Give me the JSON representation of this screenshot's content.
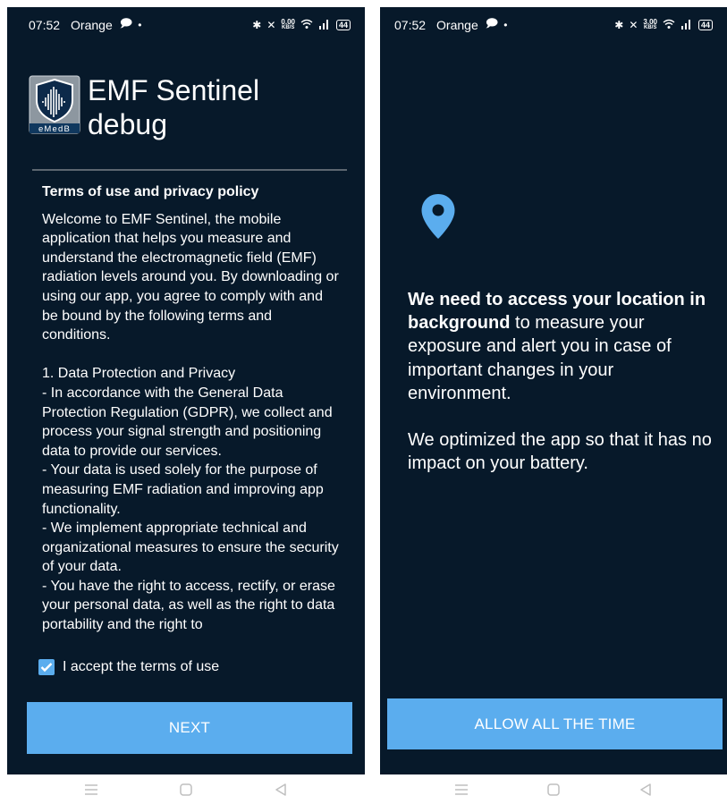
{
  "left_screen": {
    "status": {
      "time": "07:52",
      "carrier": "Orange",
      "netspeed_value": "0.00",
      "netspeed_unit": "KB/S",
      "battery": "44"
    },
    "app": {
      "logo_text": "eMedB",
      "title_line1": "EMF Sentinel",
      "title_line2": "debug"
    },
    "terms": {
      "heading": "Terms of use and privacy policy",
      "body": "Welcome to EMF Sentinel, the mobile application that helps you measure and understand the electromagnetic field (EMF) radiation levels around you. By downloading or using our app, you agree to comply with and be bound by the following terms and conditions.\n\n 1. Data Protection and Privacy\n - In accordance with the General Data Protection Regulation (GDPR), we collect and process your signal strength and positioning data to provide our services.\n - Your data is used solely for the purpose of measuring EMF radiation and improving app functionality.\n - We implement appropriate technical and organizational measures to ensure the security of your data.\n - You have the right to access, rectify, or erase your personal data, as well as the right to data portability and the right to"
    },
    "checkbox": {
      "label": "I accept the terms of use",
      "checked": true
    },
    "next_label": "NEXT"
  },
  "right_screen": {
    "status": {
      "time": "07:52",
      "carrier": "Orange",
      "netspeed_value": "3.00",
      "netspeed_unit": "KB/S",
      "battery": "44"
    },
    "message": {
      "bold": "We need to access your location in background",
      "rest": " to measure your exposure and alert you in case of important changes in your environment.",
      "battery_note": "We optimized the app so that it has no impact on your battery."
    },
    "allow_label": "ALLOW ALL THE TIME"
  },
  "colors": {
    "background": "#07192a",
    "accent": "#5badee",
    "divider": "#5c6670",
    "nav_icons": "#bfbfbf"
  },
  "icons": {
    "status": [
      "chat-bubble-icon",
      "dot-icon",
      "bluetooth-icon",
      "mute-icon",
      "wifi-icon",
      "signal-icon",
      "battery-icon"
    ],
    "content": [
      "shield-soundwave-logo",
      "location-pin-icon",
      "checkbox-checked-icon"
    ],
    "nav": [
      "menu-icon",
      "home-icon",
      "back-icon"
    ]
  }
}
